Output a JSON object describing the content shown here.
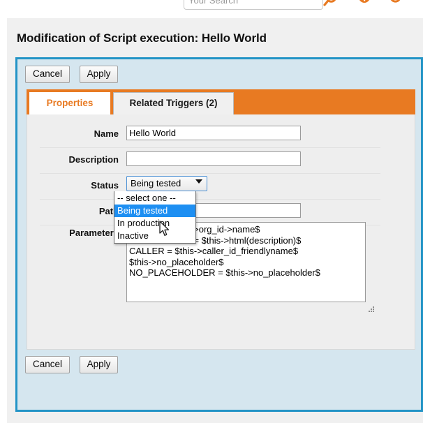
{
  "topbar": {
    "search": {
      "placeholder": "Your Search",
      "value": ""
    },
    "icons": [
      {
        "name": "search-icon",
        "label": "Search"
      },
      {
        "name": "info-icon",
        "label": "Information"
      },
      {
        "name": "user-menu-icon",
        "label": "User menu"
      }
    ]
  },
  "page": {
    "title": "Modification of Script execution: Hello World"
  },
  "toolbar_top": {
    "cancel_label": "Cancel",
    "apply_label": "Apply"
  },
  "toolbar_bottom": {
    "cancel_label": "Cancel",
    "apply_label": "Apply"
  },
  "tabs": [
    {
      "label": "Properties",
      "active": true
    },
    {
      "label": "Related Triggers (2)",
      "active": false
    }
  ],
  "form": {
    "name": {
      "label": "Name",
      "value": "Hello World"
    },
    "description": {
      "label": "Description",
      "value": ""
    },
    "status": {
      "label": "Status",
      "selected": "Being tested",
      "open": true,
      "options": [
        "-- select one --",
        "Being tested",
        "In production",
        "Inactive"
      ],
      "highlighted_index": 1
    },
    "path": {
      "label": "Path",
      "value": ""
    },
    "parameters": {
      "label": "Parameters",
      "value": "$this->caller_id->org_id->name$\nDESCRIPTION = $this->html(description)$\nCALLER = $this->caller_id_friendlyname$\n$this->no_placeholder$\nNO_PLACEHOLDER = $this->no_placeholder$"
    }
  },
  "colors": {
    "accent_orange": "#e87a22",
    "panel_blue_border": "#2394c6",
    "panel_blue_bg": "#d5e6ef",
    "form_bg": "#eeeeee",
    "select_highlight": "#1e8ff2"
  }
}
